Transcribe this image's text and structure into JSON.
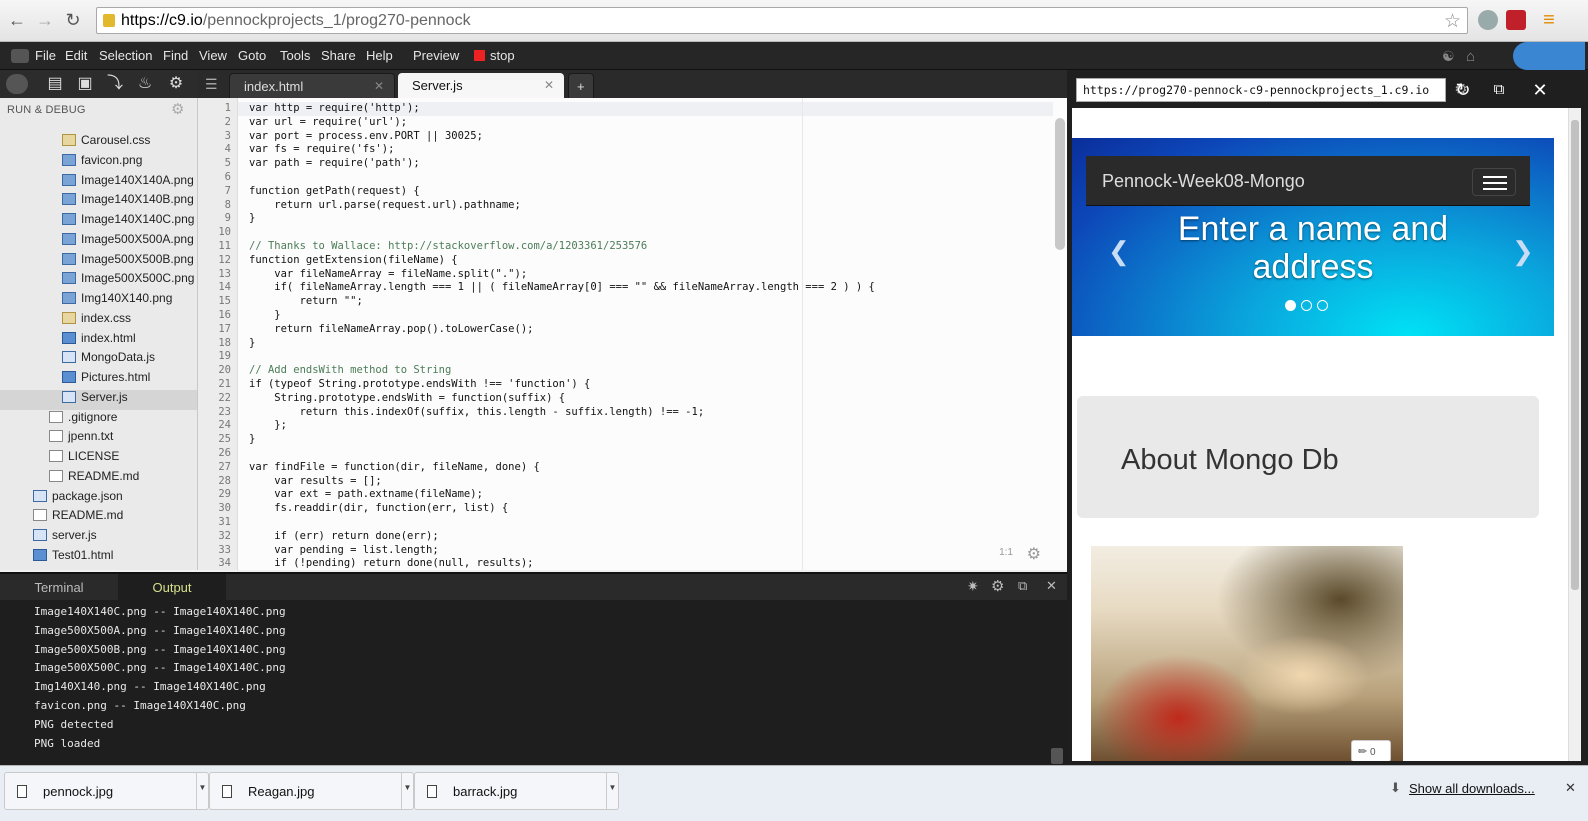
{
  "browser": {
    "url_host": "https://c9.io",
    "url_path": "/pennockprojects_1/prog270-pennock"
  },
  "menubar": {
    "items": [
      "File",
      "Edit",
      "Selection",
      "Find",
      "View",
      "Goto",
      "Tools",
      "Share",
      "Help"
    ],
    "preview_label": "Preview",
    "stop_label": "stop"
  },
  "sidebar": {
    "title": "RUN & DEBUG",
    "files": [
      {
        "name": "Carousel.css",
        "type": "css",
        "indent": 2
      },
      {
        "name": "favicon.png",
        "type": "img",
        "indent": 2
      },
      {
        "name": "Image140X140A.png",
        "type": "img",
        "indent": 2
      },
      {
        "name": "Image140X140B.png",
        "type": "img",
        "indent": 2
      },
      {
        "name": "Image140X140C.png",
        "type": "img",
        "indent": 2
      },
      {
        "name": "Image500X500A.png",
        "type": "img",
        "indent": 2
      },
      {
        "name": "Image500X500B.png",
        "type": "img",
        "indent": 2
      },
      {
        "name": "Image500X500C.png",
        "type": "img",
        "indent": 2
      },
      {
        "name": "Img140X140.png",
        "type": "img",
        "indent": 2
      },
      {
        "name": "index.css",
        "type": "css",
        "indent": 2
      },
      {
        "name": "index.html",
        "type": "html",
        "indent": 2
      },
      {
        "name": "MongoData.js",
        "type": "js",
        "indent": 2
      },
      {
        "name": "Pictures.html",
        "type": "html",
        "indent": 2
      },
      {
        "name": "Server.js",
        "type": "js",
        "indent": 2,
        "selected": true
      },
      {
        "name": ".gitignore",
        "type": "txt",
        "indent": 1
      },
      {
        "name": "jpenn.txt",
        "type": "txt",
        "indent": 1
      },
      {
        "name": "LICENSE",
        "type": "txt",
        "indent": 1
      },
      {
        "name": "README.md",
        "type": "txt",
        "indent": 1
      },
      {
        "name": "package.json",
        "type": "js",
        "indent": 0
      },
      {
        "name": "README.md",
        "type": "txt",
        "indent": 0
      },
      {
        "name": "server.js",
        "type": "js",
        "indent": 0
      },
      {
        "name": "Test01.html",
        "type": "html",
        "indent": 0
      }
    ]
  },
  "editor": {
    "tabs": [
      {
        "label": "index.html",
        "active": false
      },
      {
        "label": "Server.js",
        "active": true
      }
    ],
    "add_tab": "+",
    "cursor_pos": "1:1",
    "lines": [
      "var http = require('http');",
      "var url = require('url');",
      "var port = process.env.PORT || 30025;",
      "var fs = require('fs');",
      "var path = require('path');",
      "",
      "function getPath(request) {",
      "    return url.parse(request.url).pathname;",
      "}",
      "",
      "// Thanks to Wallace: http://stackoverflow.com/a/1203361/253576",
      "function getExtension(fileName) {",
      "    var fileNameArray = fileName.split(\".\");",
      "    if( fileNameArray.length === 1 || ( fileNameArray[0] === \"\" && fileNameArray.length === 2 ) ) {",
      "        return \"\";",
      "    }",
      "    return fileNameArray.pop().toLowerCase();",
      "}",
      "",
      "// Add endsWith method to String",
      "if (typeof String.prototype.endsWith !== 'function') {",
      "    String.prototype.endsWith = function(suffix) {",
      "        return this.indexOf(suffix, this.length - suffix.length) !== -1;",
      "    };",
      "}",
      "",
      "var findFile = function(dir, fileName, done) {",
      "    var results = [];",
      "    var ext = path.extname(fileName);",
      "    fs.readdir(dir, function(err, list) {",
      "",
      "    if (err) return done(err);",
      "    var pending = list.length;",
      "    if (!pending) return done(null, results);"
    ]
  },
  "bottom_panel": {
    "tabs": [
      "Terminal",
      "Output"
    ],
    "active_tab": "Output",
    "output_lines": [
      "Image140X140C.png -- Image140X140C.png",
      "Image500X500A.png -- Image140X140C.png",
      "Image500X500B.png -- Image140X140C.png",
      "Image500X500C.png -- Image140X140C.png",
      "Img140X140.png -- Image140X140C.png",
      "favicon.png -- Image140X140C.png",
      "PNG detected",
      "PNG loaded"
    ]
  },
  "preview": {
    "url": "https://prog270-pennock-c9-pennockprojects_1.c9.io",
    "brand": "Pennock-Week08-Mongo",
    "caption": "Enter a name and address",
    "jumbotron_heading": "About Mongo Db",
    "comment_count": "0"
  },
  "downloads": {
    "items": [
      "pennock.jpg",
      "Reagan.jpg",
      "barrack.jpg"
    ],
    "show_all": "Show all downloads..."
  }
}
